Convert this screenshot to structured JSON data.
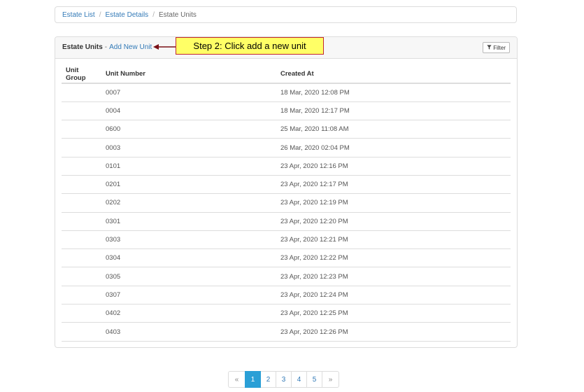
{
  "breadcrumb": {
    "items": [
      "Estate List",
      "Estate Details",
      "Estate Units"
    ],
    "separator": "/"
  },
  "panel": {
    "title": "Estate Units",
    "title_separator": "-",
    "add_link": "Add New Unit",
    "filter_button": "Filter"
  },
  "callout": {
    "text": "Step 2: Click add a new unit"
  },
  "table": {
    "headers": [
      "Unit Group",
      "Unit Number",
      "Created At"
    ],
    "rows": [
      {
        "group": "",
        "number": "0007",
        "created": "18 Mar, 2020 12:08 PM"
      },
      {
        "group": "",
        "number": "0004",
        "created": "18 Mar, 2020 12:17 PM"
      },
      {
        "group": "",
        "number": "0600",
        "created": "25 Mar, 2020 11:08 AM"
      },
      {
        "group": "",
        "number": "0003",
        "created": "26 Mar, 2020 02:04 PM"
      },
      {
        "group": "",
        "number": "0101",
        "created": "23 Apr, 2020 12:16 PM"
      },
      {
        "group": "",
        "number": "0201",
        "created": "23 Apr, 2020 12:17 PM"
      },
      {
        "group": "",
        "number": "0202",
        "created": "23 Apr, 2020 12:19 PM"
      },
      {
        "group": "",
        "number": "0301",
        "created": "23 Apr, 2020 12:20 PM"
      },
      {
        "group": "",
        "number": "0303",
        "created": "23 Apr, 2020 12:21 PM"
      },
      {
        "group": "",
        "number": "0304",
        "created": "23 Apr, 2020 12:22 PM"
      },
      {
        "group": "",
        "number": "0305",
        "created": "23 Apr, 2020 12:23 PM"
      },
      {
        "group": "",
        "number": "0307",
        "created": "23 Apr, 2020 12:24 PM"
      },
      {
        "group": "",
        "number": "0402",
        "created": "23 Apr, 2020 12:25 PM"
      },
      {
        "group": "",
        "number": "0403",
        "created": "23 Apr, 2020 12:26 PM"
      }
    ]
  },
  "pagination": {
    "prev": "«",
    "next": "»",
    "pages": [
      "1",
      "2",
      "3",
      "4",
      "5"
    ],
    "current": "1"
  },
  "colors": {
    "link": "#337ab7",
    "callout_bg": "#ffff66",
    "callout_border": "#c1272d",
    "active_page": "#2a9fd6"
  },
  "icons": {
    "filter": "filter-icon",
    "callout_arrow": "arrow-left-icon"
  }
}
